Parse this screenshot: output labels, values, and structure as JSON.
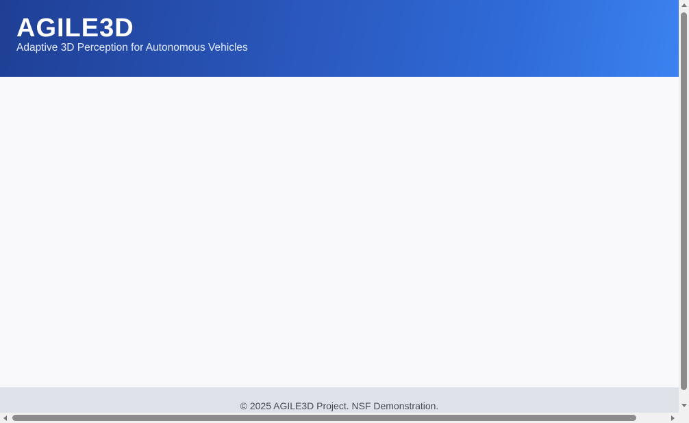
{
  "header": {
    "title": "AGILE3D",
    "tagline": "Adaptive 3D Perception for Autonomous Vehicles"
  },
  "footer": {
    "text": "© 2025 AGILE3D Project. NSF Demonstration."
  },
  "colors": {
    "header_gradient_start": "#1f3f95",
    "header_gradient_end": "#3b82f0",
    "page_background": "#f9f9fc",
    "footer_background": "#e0e2ea"
  },
  "icons": {
    "scroll_up": "triangle-up",
    "scroll_down": "triangle-down",
    "scroll_left": "triangle-left",
    "scroll_right": "triangle-right"
  }
}
